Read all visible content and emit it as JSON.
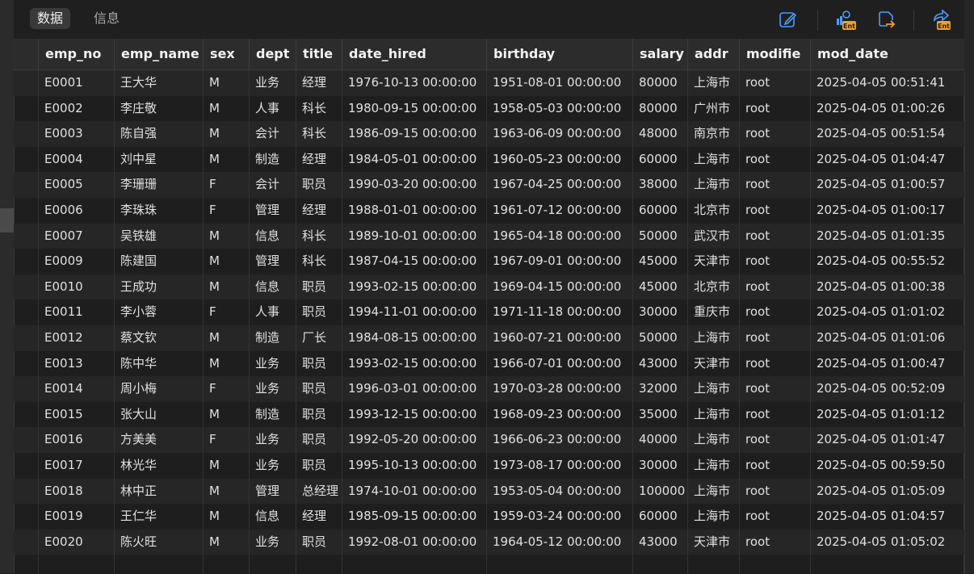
{
  "tabs": [
    {
      "label": "数据",
      "active": true
    },
    {
      "label": "信息",
      "active": false
    }
  ],
  "toolbar_icons": [
    "edit-icon",
    "user-ent-icon",
    "export-icon",
    "share-ent-icon"
  ],
  "columns": [
    "emp_no",
    "emp_name",
    "sex",
    "dept",
    "title",
    "date_hired",
    "birthday",
    "salary",
    "addr",
    "modifie",
    "mod_date"
  ],
  "rows": [
    [
      "E0001",
      "王大华",
      "M",
      "业务",
      "经理",
      "1976-10-13 00:00:00",
      "1951-08-01 00:00:00",
      "80000",
      "上海市",
      "root",
      "2025-04-05 00:51:41"
    ],
    [
      "E0002",
      "李庄敬",
      "M",
      "人事",
      "科长",
      "1980-09-15 00:00:00",
      "1958-05-03 00:00:00",
      "80000",
      "广州市",
      "root",
      "2025-04-05 01:00:26"
    ],
    [
      "E0003",
      "陈自强",
      "M",
      "会计",
      "科长",
      "1986-09-15 00:00:00",
      "1963-06-09 00:00:00",
      "48000",
      "南京市",
      "root",
      "2025-04-05 00:51:54"
    ],
    [
      "E0004",
      "刘中星",
      "M",
      "制造",
      "经理",
      "1984-05-01 00:00:00",
      "1960-05-23 00:00:00",
      "60000",
      "上海市",
      "root",
      "2025-04-05 01:04:47"
    ],
    [
      "E0005",
      "李珊珊",
      "F",
      "会计",
      "职员",
      "1990-03-20 00:00:00",
      "1967-04-25 00:00:00",
      "38000",
      "上海市",
      "root",
      "2025-04-05 01:00:57"
    ],
    [
      "E0006",
      "李珠珠",
      "F",
      "管理",
      "经理",
      "1988-01-01 00:00:00",
      "1961-07-12 00:00:00",
      "60000",
      "北京市",
      "root",
      "2025-04-05 01:00:17"
    ],
    [
      "E0007",
      "吴铁雄",
      "M",
      "信息",
      "科长",
      "1989-10-01 00:00:00",
      "1965-04-18 00:00:00",
      "50000",
      "武汉市",
      "root",
      "2025-04-05 01:01:35"
    ],
    [
      "E0009",
      "陈建国",
      "M",
      "管理",
      "科长",
      "1987-04-15 00:00:00",
      "1967-09-01 00:00:00",
      "45000",
      "天津市",
      "root",
      "2025-04-05 00:55:52"
    ],
    [
      "E0010",
      "王成功",
      "M",
      "信息",
      "职员",
      "1993-02-15 00:00:00",
      "1969-04-15 00:00:00",
      "45000",
      "北京市",
      "root",
      "2025-04-05 01:00:38"
    ],
    [
      "E0011",
      "李小蓉",
      "F",
      "人事",
      "职员",
      "1994-11-01 00:00:00",
      "1971-11-18 00:00:00",
      "30000",
      "重庆市",
      "root",
      "2025-04-05 01:01:02"
    ],
    [
      "E0012",
      "蔡文钦",
      "M",
      "制造",
      "厂长",
      "1984-08-15 00:00:00",
      "1960-07-21 00:00:00",
      "50000",
      "上海市",
      "root",
      "2025-04-05 01:01:06"
    ],
    [
      "E0013",
      "陈中华",
      "M",
      "业务",
      "职员",
      "1993-02-15 00:00:00",
      "1966-07-01 00:00:00",
      "43000",
      "天津市",
      "root",
      "2025-04-05 01:00:47"
    ],
    [
      "E0014",
      "周小梅",
      "F",
      "业务",
      "职员",
      "1996-03-01 00:00:00",
      "1970-03-28 00:00:00",
      "32000",
      "上海市",
      "root",
      "2025-04-05 00:52:09"
    ],
    [
      "E0015",
      "张大山",
      "M",
      "制造",
      "职员",
      "1993-12-15 00:00:00",
      "1968-09-23 00:00:00",
      "35000",
      "上海市",
      "root",
      "2025-04-05 01:01:12"
    ],
    [
      "E0016",
      "方美美",
      "F",
      "业务",
      "职员",
      "1992-05-20 00:00:00",
      "1966-06-23 00:00:00",
      "40000",
      "上海市",
      "root",
      "2025-04-05 01:01:47"
    ],
    [
      "E0017",
      "林光华",
      "M",
      "业务",
      "职员",
      "1995-10-13 00:00:00",
      "1973-08-17 00:00:00",
      "30000",
      "上海市",
      "root",
      "2025-04-05 00:59:50"
    ],
    [
      "E0018",
      "林中正",
      "M",
      "管理",
      "总经理",
      "1974-10-01 00:00:00",
      "1953-05-04 00:00:00",
      "100000",
      "上海市",
      "root",
      "2025-04-05 01:05:09"
    ],
    [
      "E0019",
      "王仁华",
      "M",
      "信息",
      "经理",
      "1985-09-15 00:00:00",
      "1959-03-24 00:00:00",
      "60000",
      "上海市",
      "root",
      "2025-04-05 01:04:57"
    ],
    [
      "E0020",
      "陈火旺",
      "M",
      "业务",
      "职员",
      "1992-08-01 00:00:00",
      "1964-05-12 00:00:00",
      "43000",
      "天津市",
      "root",
      "2025-04-05 01:05:02"
    ]
  ],
  "colors": {
    "accent": "#4a9eff",
    "ent_badge": "#f0a030",
    "export_arrow": "#f0a030"
  }
}
